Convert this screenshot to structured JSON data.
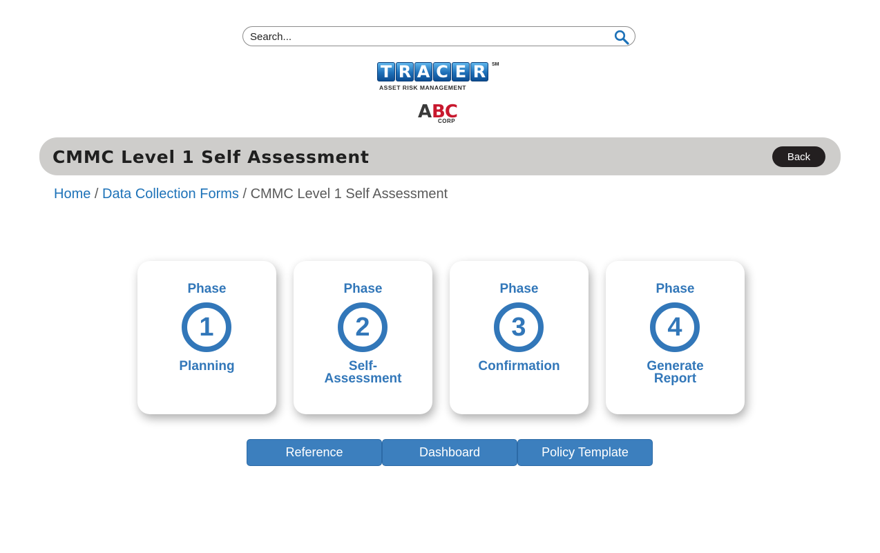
{
  "search": {
    "placeholder": "Search..."
  },
  "logo": {
    "tracer_letters": [
      "T",
      "R",
      "A",
      "C",
      "E",
      "R"
    ],
    "tracer_sm": "SM",
    "tracer_subtitle": "ASSET RISK MANAGEMENT",
    "abc_a": "A",
    "abc_bc": "BC",
    "abc_corp": "CORP"
  },
  "header": {
    "title": "CMMC Level 1 Self Assessment",
    "back_label": "Back"
  },
  "breadcrumb": {
    "items": [
      "Home",
      "Data Collection Forms",
      "CMMC Level 1 Self Assessment"
    ],
    "separator": "/"
  },
  "phases": [
    {
      "word": "Phase",
      "number": "1",
      "label": "Planning"
    },
    {
      "word": "Phase",
      "number": "2",
      "label": "Self-\nAssessment"
    },
    {
      "word": "Phase",
      "number": "3",
      "label": "Confirmation"
    },
    {
      "word": "Phase",
      "number": "4",
      "label": "Generate\nReport"
    }
  ],
  "actions": {
    "reference": "Reference",
    "dashboard": "Dashboard",
    "policy_template": "Policy Template"
  },
  "colors": {
    "accent_blue": "#3277b9",
    "button_blue": "#3c7fbe",
    "link_blue": "#1d72b8",
    "header_gray": "#cecdcb",
    "back_button_dark": "#231f20",
    "abc_red": "#c8182e"
  }
}
